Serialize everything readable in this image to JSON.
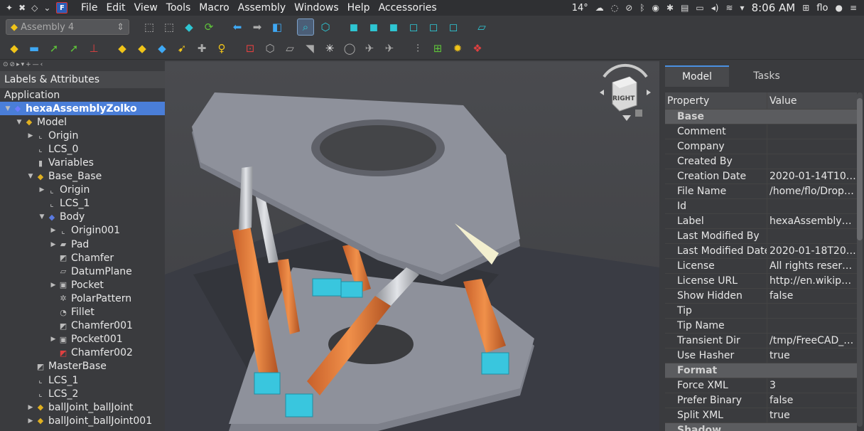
{
  "menubar": {
    "items": [
      "File",
      "Edit",
      "View",
      "Tools",
      "Macro",
      "Assembly",
      "Windows",
      "Help",
      "Accessories"
    ],
    "weather": "14°",
    "clock": "8:06 AM",
    "user": "flo"
  },
  "toolbar": {
    "workbench": "Assembly 4"
  },
  "tree": {
    "header": "Labels & Attributes",
    "section": "Application",
    "rows": [
      {
        "label": "hexaAssemblyZolko",
        "depth": 0,
        "arrow": "▼",
        "icon": "assembly-icon",
        "glyph": "◆",
        "color": "#6b7cff",
        "selected": true
      },
      {
        "label": "Model",
        "depth": 1,
        "arrow": "▼",
        "icon": "model-icon",
        "glyph": "◆",
        "color": "#e0b020"
      },
      {
        "label": "Origin",
        "depth": 2,
        "arrow": "▶",
        "icon": "origin-icon",
        "glyph": "⌞",
        "color": "#cccccc"
      },
      {
        "label": "LCS_0",
        "depth": 2,
        "arrow": "",
        "icon": "lcs-icon",
        "glyph": "⌞",
        "color": "#cccccc"
      },
      {
        "label": "Variables",
        "depth": 2,
        "arrow": "",
        "icon": "variables-icon",
        "glyph": "▮",
        "color": "#bbbbbb"
      },
      {
        "label": "Base_Base",
        "depth": 2,
        "arrow": "▼",
        "icon": "link-icon",
        "glyph": "◆",
        "color": "#e0b020"
      },
      {
        "label": "Origin",
        "depth": 3,
        "arrow": "▶",
        "icon": "origin-icon",
        "glyph": "⌞",
        "color": "#cccccc"
      },
      {
        "label": "LCS_1",
        "depth": 3,
        "arrow": "",
        "icon": "lcs-icon",
        "glyph": "⌞",
        "color": "#cccccc"
      },
      {
        "label": "Body",
        "depth": 3,
        "arrow": "▼",
        "icon": "body-icon",
        "glyph": "◆",
        "color": "#5a7ae0"
      },
      {
        "label": "Origin001",
        "depth": 4,
        "arrow": "▶",
        "icon": "origin-icon",
        "glyph": "⌞",
        "color": "#cccccc"
      },
      {
        "label": "Pad",
        "depth": 4,
        "arrow": "▶",
        "icon": "pad-icon",
        "glyph": "▰",
        "color": "#bbbbbb"
      },
      {
        "label": "Chamfer",
        "depth": 4,
        "arrow": "",
        "icon": "chamfer-icon",
        "glyph": "◩",
        "color": "#bbbbbb"
      },
      {
        "label": "DatumPlane",
        "depth": 4,
        "arrow": "",
        "icon": "datum-plane-icon",
        "glyph": "▱",
        "color": "#bbbbbb"
      },
      {
        "label": "Pocket",
        "depth": 4,
        "arrow": "▶",
        "icon": "pocket-icon",
        "glyph": "▣",
        "color": "#bbbbbb"
      },
      {
        "label": "PolarPattern",
        "depth": 4,
        "arrow": "",
        "icon": "polar-pattern-icon",
        "glyph": "✲",
        "color": "#bbbbbb"
      },
      {
        "label": "Fillet",
        "depth": 4,
        "arrow": "",
        "icon": "fillet-icon",
        "glyph": "◔",
        "color": "#bbbbbb"
      },
      {
        "label": "Chamfer001",
        "depth": 4,
        "arrow": "",
        "icon": "chamfer-icon",
        "glyph": "◩",
        "color": "#bbbbbb"
      },
      {
        "label": "Pocket001",
        "depth": 4,
        "arrow": "▶",
        "icon": "pocket-icon",
        "glyph": "▣",
        "color": "#bbbbbb"
      },
      {
        "label": "Chamfer002",
        "depth": 4,
        "arrow": "",
        "icon": "chamfer-tip-icon",
        "glyph": "◩",
        "color": "#e04040"
      },
      {
        "label": "MasterBase",
        "depth": 2,
        "arrow": "",
        "icon": "part-icon",
        "glyph": "◩",
        "color": "#bbbbbb"
      },
      {
        "label": "LCS_1",
        "depth": 2,
        "arrow": "",
        "icon": "lcs-icon",
        "glyph": "⌞",
        "color": "#cccccc"
      },
      {
        "label": "LCS_2",
        "depth": 2,
        "arrow": "",
        "icon": "lcs-icon",
        "glyph": "⌞",
        "color": "#cccccc"
      },
      {
        "label": "ballJoint_ballJoint",
        "depth": 2,
        "arrow": "▶",
        "icon": "link-icon",
        "glyph": "◆",
        "color": "#e0b020"
      },
      {
        "label": "ballJoint_ballJoint001",
        "depth": 2,
        "arrow": "▶",
        "icon": "link-icon",
        "glyph": "◆",
        "color": "#e0b020"
      }
    ]
  },
  "navcube": {
    "face": "RIGHT"
  },
  "tabs": {
    "model": "Model",
    "tasks": "Tasks"
  },
  "props": {
    "col_property": "Property",
    "col_value": "Value",
    "rows": [
      {
        "type": "group",
        "name": "Base"
      },
      {
        "name": "Comment",
        "value": ""
      },
      {
        "name": "Company",
        "value": ""
      },
      {
        "name": "Created By",
        "value": ""
      },
      {
        "name": "Creation Date",
        "value": "2020-01-14T10:10..."
      },
      {
        "name": "File Name",
        "value": "/home/flo/Dropb..."
      },
      {
        "name": "Id",
        "value": ""
      },
      {
        "name": "Label",
        "value": "hexaAssemblyZol..."
      },
      {
        "name": "Last Modified By",
        "value": ""
      },
      {
        "name": "Last Modified Date",
        "value": "2020-01-18T20:4..."
      },
      {
        "name": "License",
        "value": "All rights reserved"
      },
      {
        "name": "License URL",
        "value": "http://en.wikipedi..."
      },
      {
        "name": "Show Hidden",
        "value": "false"
      },
      {
        "name": "Tip",
        "value": ""
      },
      {
        "name": "Tip Name",
        "value": ""
      },
      {
        "name": "Transient Dir",
        "value": "/tmp/FreeCAD_D..."
      },
      {
        "name": "Use Hasher",
        "value": "true"
      },
      {
        "type": "group",
        "name": "Format"
      },
      {
        "name": "Force XML",
        "value": "3"
      },
      {
        "name": "Prefer Binary",
        "value": "false"
      },
      {
        "name": "Split XML",
        "value": "true"
      },
      {
        "type": "group",
        "name": "Shadow"
      }
    ]
  },
  "colors": {
    "selection": "#4a7ed8",
    "platform": "#8e919b",
    "leg_orange": "#e8803a",
    "joint_cyan": "#39c6de",
    "rod_gray": "#b9bcc2"
  }
}
